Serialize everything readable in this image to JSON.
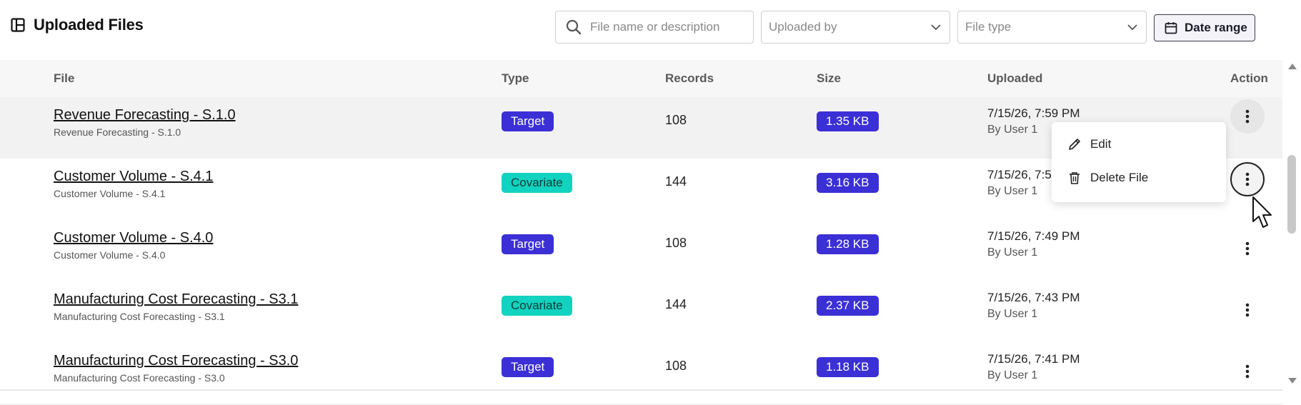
{
  "header": {
    "title": "Uploaded Files",
    "search_placeholder": "File name or description",
    "uploaded_by_placeholder": "Uploaded by",
    "file_type_placeholder": "File type",
    "date_range_label": "Date range"
  },
  "table": {
    "columns": [
      "File",
      "Type",
      "Records",
      "Size",
      "Uploaded",
      "Action"
    ],
    "rows": [
      {
        "name": "Revenue Forecasting - S.1.0",
        "desc": "Revenue Forecasting - S.1.0",
        "type": "Target",
        "records": "108",
        "size": "1.35 KB",
        "date": "7/15/26, 7:59 PM",
        "by": "By User 1"
      },
      {
        "name": "Customer Volume - S.4.1",
        "desc": "Customer Volume - S.4.1",
        "type": "Covariate",
        "records": "144",
        "size": "3.16 KB",
        "date": "7/15/26, 7:5",
        "by": "By User 1"
      },
      {
        "name": "Customer Volume - S.4.0",
        "desc": "Customer Volume - S.4.0",
        "type": "Target",
        "records": "108",
        "size": "1.28 KB",
        "date": "7/15/26, 7:49 PM",
        "by": "By User 1"
      },
      {
        "name": "Manufacturing Cost Forecasting - S3.1",
        "desc": "Manufacturing Cost Forecasting - S3.1",
        "type": "Covariate",
        "records": "144",
        "size": "2.37 KB",
        "date": "7/15/26, 7:43 PM",
        "by": "By User 1"
      },
      {
        "name": "Manufacturing Cost Forecasting - S3.0",
        "desc": "Manufacturing Cost Forecasting - S3.0",
        "type": "Target",
        "records": "108",
        "size": "1.18 KB",
        "date": "7/15/26, 7:41 PM",
        "by": "By User 1"
      }
    ]
  },
  "menu": {
    "edit_label": "Edit",
    "delete_label": "Delete File"
  },
  "colors": {
    "target_badge": "#3b2fd6",
    "covariate_badge": "#11d3c0",
    "size_badge": "#3b2fd6"
  }
}
